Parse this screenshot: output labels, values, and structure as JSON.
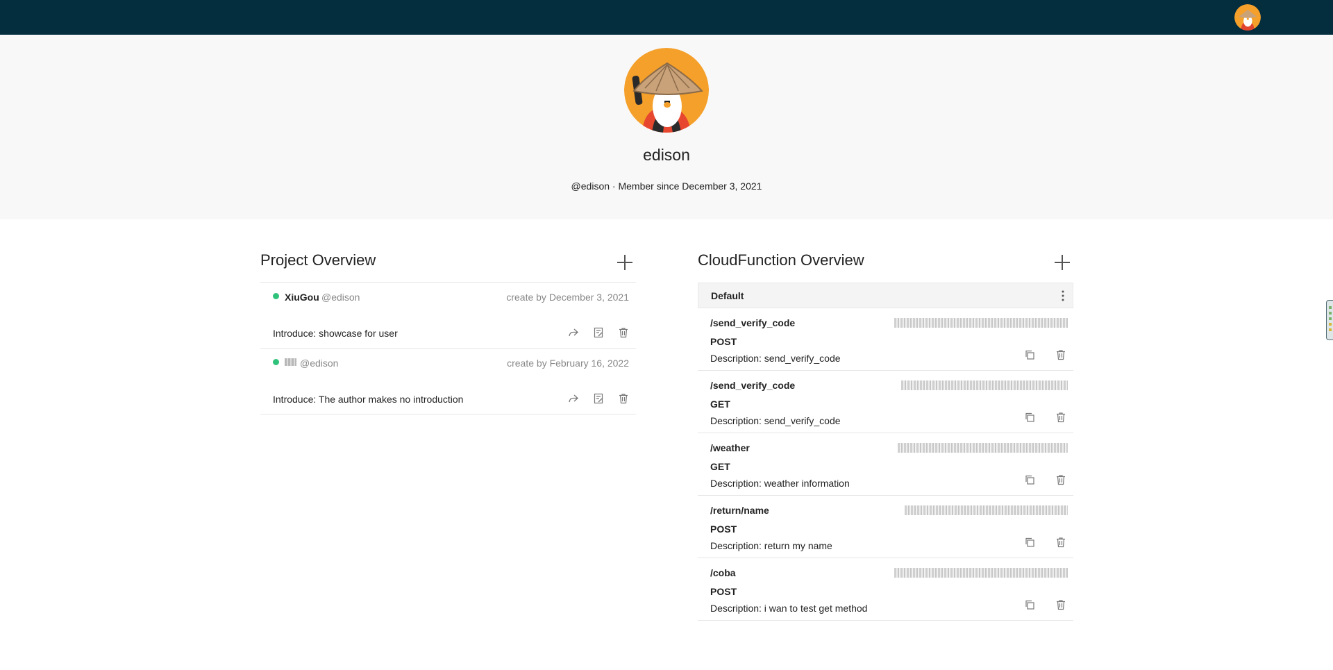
{
  "profile": {
    "name": "edison",
    "meta": "@edison · Member since December 3, 2021"
  },
  "projects": {
    "title": "Project Overview",
    "items": [
      {
        "name": "XiuGou",
        "user": "@edison",
        "date": "create by December 3, 2021",
        "intro": "Introduce: showcase for user"
      },
      {
        "name": "",
        "user": "@edison",
        "date": "create by February 16, 2022",
        "intro": "Introduce: The author makes no introduction"
      }
    ]
  },
  "cloud": {
    "title": "CloudFunction Overview",
    "group": "Default",
    "items": [
      {
        "path": "/send_verify_code",
        "method": "POST",
        "desc": "Description: send_verify_code"
      },
      {
        "path": "/send_verify_code",
        "method": "GET",
        "desc": "Description: send_verify_code"
      },
      {
        "path": "/weather",
        "method": "GET",
        "desc": "Description: weather information"
      },
      {
        "path": "/return/name",
        "method": "POST",
        "desc": "Description: return my name"
      },
      {
        "path": "/coba",
        "method": "POST",
        "desc": "Description: i wan to test get method"
      }
    ]
  },
  "colors": {
    "topbar": "#042d3d",
    "avatar_bg": "#f5a02a",
    "status_dot": "#2fc27a"
  },
  "icons": [
    "share-icon",
    "edit-icon",
    "trash-icon",
    "copy-icon",
    "more-vertical-icon",
    "plus-icon"
  ]
}
